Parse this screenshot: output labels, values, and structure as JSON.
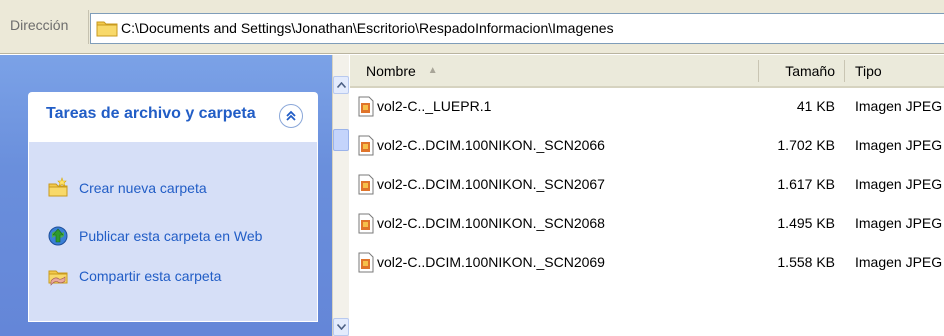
{
  "address": {
    "label": "Dirección",
    "path": "C:\\Documents and Settings\\Jonathan\\Escritorio\\RespadoInformacion\\Imagenes",
    "icon": "folder-icon"
  },
  "tasks": {
    "title": "Tareas de archivo y carpeta",
    "collapse_icon": "chevron-double-up-icon",
    "items": [
      {
        "label": "Crear nueva carpeta",
        "icon": "new-folder-icon"
      },
      {
        "label": "Publicar esta carpeta en Web",
        "icon": "publish-web-icon"
      },
      {
        "label": "Compartir esta carpeta",
        "icon": "share-folder-icon"
      }
    ]
  },
  "columns": {
    "name": "Nombre",
    "size": "Tamaño",
    "type": "Tipo"
  },
  "files": [
    {
      "name": "vol2-C.._LUEPR.1",
      "size": "41 KB",
      "type": "Imagen JPEG"
    },
    {
      "name": "vol2-C..DCIM.100NIKON._SCN2066",
      "size": "1.702 KB",
      "type": "Imagen JPEG"
    },
    {
      "name": "vol2-C..DCIM.100NIKON._SCN2067",
      "size": "1.617 KB",
      "type": "Imagen JPEG"
    },
    {
      "name": "vol2-C..DCIM.100NIKON._SCN2068",
      "size": "1.495 KB",
      "type": "Imagen JPEG"
    },
    {
      "name": "vol2-C..DCIM.100NIKON._SCN2069",
      "size": "1.558 KB",
      "type": "Imagen JPEG"
    }
  ],
  "colors": {
    "task_pane_blue": "#6a8fdc",
    "task_link": "#215dc6",
    "header_bg": "#ebeadb"
  }
}
